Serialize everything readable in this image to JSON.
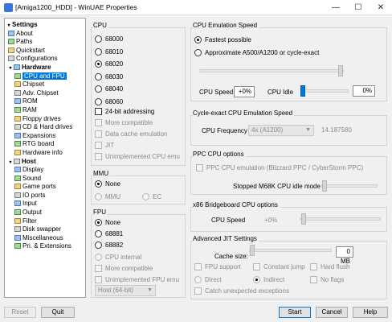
{
  "window": {
    "title": "[Amiga1200_HDD] - WinUAE Properties",
    "min": "—",
    "max": "☐",
    "close": "✕"
  },
  "tree": [
    {
      "label": "Settings",
      "kind": "group",
      "level": 0
    },
    {
      "label": "About",
      "level": 1
    },
    {
      "label": "Paths",
      "level": 1
    },
    {
      "label": "Quickstart",
      "level": 1
    },
    {
      "label": "Configurations",
      "level": 1
    },
    {
      "label": "Hardware",
      "kind": "group",
      "level": 1
    },
    {
      "label": "CPU and FPU",
      "level": 2,
      "selected": true
    },
    {
      "label": "Chipset",
      "level": 2
    },
    {
      "label": "Adv. Chipset",
      "level": 2
    },
    {
      "label": "ROM",
      "level": 2
    },
    {
      "label": "RAM",
      "level": 2
    },
    {
      "label": "Floppy drives",
      "level": 2
    },
    {
      "label": "CD & Hard drives",
      "level": 2
    },
    {
      "label": "Expansions",
      "level": 2
    },
    {
      "label": "RTG board",
      "level": 2
    },
    {
      "label": "Hardware info",
      "level": 2
    },
    {
      "label": "Host",
      "kind": "group",
      "level": 1
    },
    {
      "label": "Display",
      "level": 2
    },
    {
      "label": "Sound",
      "level": 2
    },
    {
      "label": "Game ports",
      "level": 2
    },
    {
      "label": "IO ports",
      "level": 2
    },
    {
      "label": "Input",
      "level": 2
    },
    {
      "label": "Output",
      "level": 2
    },
    {
      "label": "Filter",
      "level": 2
    },
    {
      "label": "Disk swapper",
      "level": 2
    },
    {
      "label": "Miscellaneous",
      "level": 2
    },
    {
      "label": "Pri. & Extensions",
      "level": 2
    }
  ],
  "cpu": {
    "title": "CPU",
    "models": [
      "68000",
      "68010",
      "68020",
      "68030",
      "68040",
      "68060"
    ],
    "selected": "68020",
    "addr24": "24-bit addressing",
    "more_compatible": "More compatible",
    "data_cache": "Data cache emulation",
    "jit": "JIT",
    "unimplemented": "Unimplemented CPU emu"
  },
  "mmu": {
    "title": "MMU",
    "none": "None",
    "mmu": "MMU",
    "ec": "EC"
  },
  "fpu": {
    "title": "FPU",
    "none": "None",
    "m68881": "68881",
    "m68882": "68882",
    "cpu_internal": "CPU internal",
    "more_compatible": "More compatible",
    "unimplemented": "Unimplemented FPU emu",
    "host_mode": "Host (64-bit)"
  },
  "speed": {
    "title": "CPU Emulation Speed",
    "fastest": "Fastest possible",
    "approx": "Approximate A500/A1200 or cycle-exact",
    "cpu_speed_label": "CPU Speed",
    "cpu_speed_value": "+0%",
    "cpu_idle_label": "CPU Idle",
    "cpu_idle_value": "0%"
  },
  "cycle_exact": {
    "title": "Cycle-exact CPU Emulation Speed",
    "freq_label": "CPU Frequency",
    "freq_combo": "4x (A1200)",
    "freq_value": "14.187580"
  },
  "ppc": {
    "title": "PPC CPU options",
    "emulation": "PPC CPU emulation (Blizzard PPC / CyberStorm PPC)",
    "idle_label": "Stopped M68K CPU idle mode"
  },
  "x86": {
    "title": "x86 Bridgeboard CPU options",
    "speed_label": "CPU Speed",
    "speed_value": "+0%"
  },
  "jit": {
    "title": "Advanced JIT Settings",
    "cache_label": "Cache size:",
    "cache_value": "0 MB",
    "fpu_support": "FPU support",
    "constant_jump": "Constant jump",
    "hard_flush": "Hard flush",
    "direct": "Direct",
    "indirect": "Indirect",
    "no_flags": "No flags",
    "catch_exceptions": "Catch unexpected exceptions"
  },
  "buttons": {
    "reset": "Reset",
    "quit": "Quit",
    "start": "Start",
    "cancel": "Cancel",
    "help": "Help"
  }
}
